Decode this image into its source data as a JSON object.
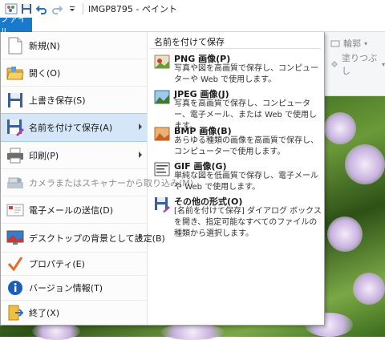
{
  "window": {
    "title": "IMGP8795 - ペイント"
  },
  "ribbon": {
    "file_tab": "ファイル",
    "outline_label": "輪郭",
    "fill_label": "塗りつぶし"
  },
  "file_menu": {
    "items": [
      {
        "label": "新規(N)",
        "icon": "new-document-icon",
        "enabled": true
      },
      {
        "label": "開く(O)",
        "icon": "open-folder-icon",
        "enabled": true
      },
      {
        "label": "上書き保存(S)",
        "icon": "save-disk-icon",
        "enabled": true
      },
      {
        "label": "名前を付けて保存(A)",
        "icon": "save-as-icon",
        "enabled": true,
        "submenu": true,
        "active": true
      },
      {
        "label": "印刷(P)",
        "icon": "printer-icon",
        "enabled": true,
        "submenu": true
      },
      {
        "label": "カメラまたはスキャナーから取り込み(M)",
        "icon": "scanner-icon",
        "enabled": false
      },
      {
        "label": "電子メールの送信(D)",
        "icon": "email-icon",
        "enabled": true
      },
      {
        "label": "デスクトップの背景として設定(B)",
        "icon": "desktop-background-icon",
        "enabled": true,
        "submenu": true
      },
      {
        "label": "プロパティ(E)",
        "icon": "checkmark-icon",
        "enabled": true
      },
      {
        "label": "バージョン情報(T)",
        "icon": "info-icon",
        "enabled": true
      },
      {
        "label": "終了(X)",
        "icon": "exit-icon",
        "enabled": true
      }
    ]
  },
  "save_as_submenu": {
    "heading": "名前を付けて保存",
    "options": [
      {
        "name": "PNG 画像(P)",
        "description": "写真や図を高画質で保存し、コンピューターや Web で使用します。",
        "icon": "png-image-icon"
      },
      {
        "name": "JPEG 画像(J)",
        "description": "写真を高画質で保存し、コンピューター、電子メール、または Web で使用します。",
        "icon": "jpeg-image-icon"
      },
      {
        "name": "BMP 画像(B)",
        "description": "あらゆる種類の画像を高画質で保存し、コンピューターで使用します。",
        "icon": "bmp-image-icon"
      },
      {
        "name": "GIF 画像(G)",
        "description": "単純な図を低画質で保存し、電子メールや Web で使用します。",
        "icon": "gif-image-icon"
      },
      {
        "name": "その他の形式(O)",
        "description": "[名前を付けて保存] ダイアログ ボックスを開き、指定可能なすべてのファイルの種類から選択します。",
        "icon": "other-formats-icon"
      }
    ]
  },
  "colors": {
    "accent": "#1979ca",
    "menu_highlight": "#d5e6f8"
  }
}
